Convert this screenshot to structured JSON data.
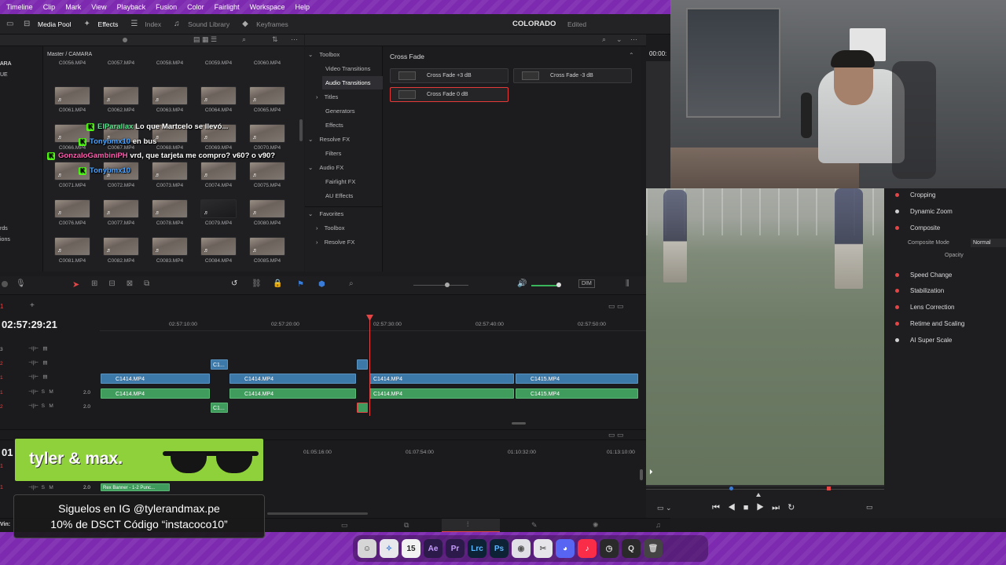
{
  "menu": [
    "Timeline",
    "Clip",
    "Mark",
    "View",
    "Playback",
    "Fusion",
    "Color",
    "Fairlight",
    "Workspace",
    "Help"
  ],
  "tabs": {
    "media_pool": "Media Pool",
    "effects": "Effects",
    "index": "Index",
    "sound_library": "Sound Library",
    "keyframes": "Keyframes"
  },
  "project": {
    "name": "COLORADO",
    "status": "Edited"
  },
  "media_pool": {
    "breadcrumb": "Master / CAMARA",
    "side_labels": [
      "ARA",
      "UE",
      "rds",
      "ions"
    ],
    "rows": [
      [
        "C0056.MP4",
        "C0057.MP4",
        "C0058.MP4",
        "C0059.MP4",
        "C0060.MP4"
      ],
      [
        "C0061.MP4",
        "C0062.MP4",
        "C0063.MP4",
        "C0064.MP4",
        "C0065.MP4"
      ],
      [
        "C0066.MP4",
        "C0067.MP4",
        "C0068.MP4",
        "C0069.MP4",
        "C0070.MP4"
      ],
      [
        "C0071.MP4",
        "C0072.MP4",
        "C0073.MP4",
        "C0074.MP4",
        "C0075.MP4"
      ],
      [
        "C0076.MP4",
        "C0077.MP4",
        "C0078.MP4",
        "C0079.MP4",
        "C0080.MP4"
      ],
      [
        "C0081.MP4",
        "C0082.MP4",
        "C0083.MP4",
        "C0084.MP4",
        "C0085.MP4"
      ]
    ]
  },
  "toolbox": {
    "items": [
      "Toolbox",
      "Video Transitions",
      "Audio Transitions",
      "Titles",
      "Generators",
      "Effects",
      "Resolve FX",
      "Filters",
      "Audio FX",
      "Fairlight FX",
      "AU Effects"
    ],
    "favorites": [
      "Favorites",
      "Toolbox",
      "Resolve FX"
    ]
  },
  "effects_panel": {
    "title": "Cross Fade",
    "items": [
      "Cross Fade +3 dB",
      "Cross Fade -3 dB",
      "Cross Fade 0 dB"
    ]
  },
  "toolbar_extra": {
    "dim": "DIM"
  },
  "timeline": {
    "timecode": "02:57:29:21",
    "ruler": [
      "02:57:10:00",
      "02:57:20:00",
      "02:57:30:00",
      "02:57:40:00",
      "02:57:50:00"
    ],
    "track_labels": [
      "3",
      "2",
      "1",
      "1",
      "2"
    ],
    "audio_level": "2.0",
    "small_clip": "C1...",
    "clips_v1": [
      "C1414.MP4",
      "C1414.MP4",
      "C1414.MP4",
      "C1415.MP4"
    ],
    "clips_a1": [
      "C1414.MP4",
      "C1414.MP4",
      "C1414.MP4",
      "C1415.MP4"
    ]
  },
  "lower_timeline": {
    "timecode": "01:",
    "ruler": [
      "01:05:16:00",
      "01:07:54:00",
      "01:10:32:00",
      "01:13:10:00"
    ],
    "track_labels": [
      "1",
      "1"
    ],
    "audio_level": "2.0",
    "clip": "Rex Banner - 1-2 Punc..."
  },
  "viewer": {
    "timecode": "00:00:"
  },
  "inspector": {
    "items": [
      "Cropping",
      "Dynamic Zoom",
      "Composite",
      "Speed Change",
      "Stabilization",
      "Lens Correction",
      "Retime and Scaling",
      "AI Super Scale"
    ],
    "composite_mode_label": "Composite Mode",
    "composite_mode_value": "Normal",
    "opacity_label": "Opacity"
  },
  "chat": [
    {
      "user": "ElParallax",
      "msg": "Lo que Martcelo se llevó...",
      "color": "#4de889"
    },
    {
      "user": "Tonybmx10",
      "msg": "en bus",
      "color": "#4aa3ff"
    },
    {
      "user": "GonzaloGambiniPH",
      "msg": "vrd, que tarjeta me compro? v60? o v90?",
      "color": "#ff5fb0"
    },
    {
      "user": "Tonybmx10",
      "msg": "",
      "color": "#4aa3ff"
    }
  ],
  "chat_badge": "K",
  "banner": {
    "brand": "tyler & max."
  },
  "promo": {
    "line1": "Siguelos en IG @tylerandmax.pe",
    "line2": "10% de DSCT Código “instacoco10”"
  },
  "app_short": "Vin:",
  "dock": [
    "Ae",
    "Pr",
    "Lrc",
    "Ps"
  ],
  "dock_date": "15"
}
